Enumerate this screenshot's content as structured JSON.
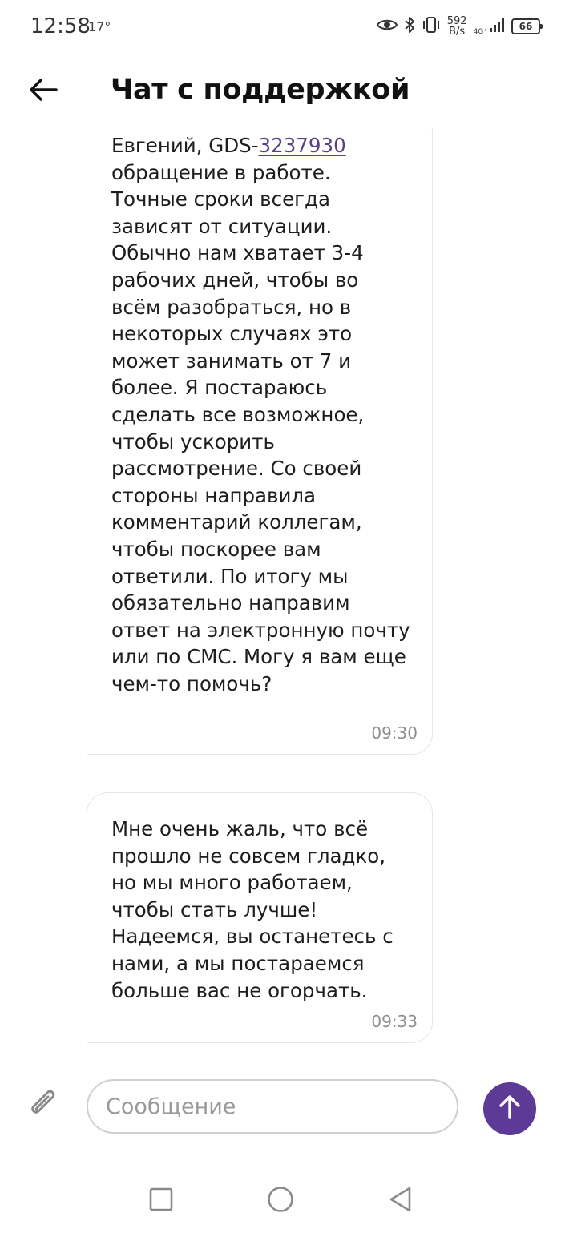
{
  "status_bar": {
    "time": "12:58",
    "temperature": "17°",
    "net_speed_value": "592",
    "net_speed_unit": "B/s",
    "signal_label": "4G⁺",
    "battery": "66"
  },
  "header": {
    "title": "Чат с поддержкой",
    "back_icon": "arrow-left-icon"
  },
  "messages": [
    {
      "greeting": "Евгений, GDS-",
      "ticket_number": "3237930",
      "text": " обращение в работе. Точные сроки всегда зависят от ситуации. Обычно нам хватает 3-4 рабочих дней, чтобы во всём разобраться, но в некоторых случаях это может занимать от 7 и более. Я постараюсь сделать все возможное, чтобы ускорить рассмотрение. Со своей стороны направила комментарий коллегам, чтобы поскорее вам ответили. По итогу мы обязательно направим ответ на электронную почту или по СМС. Могу я вам еще чем-то помочь?",
      "time": "09:30"
    },
    {
      "text": "Мне очень жаль, что всё прошло не совсем гладко, но мы много работаем, чтобы стать лучше! Надеемся, вы останетесь с нами, а мы постараемся больше вас не огорчать.",
      "time": "09:33"
    }
  ],
  "composer": {
    "placeholder": "Сообщение",
    "value": "",
    "attach_icon": "paperclip-icon",
    "send_icon": "arrow-up-icon"
  },
  "colors": {
    "accent": "#5d3a96",
    "link": "#5b3f86",
    "bubble_border": "#e6e6e6",
    "time_text": "#8d8d8d"
  },
  "nav_bar": {
    "icons": [
      "square-icon",
      "circle-icon",
      "triangle-back-icon"
    ]
  }
}
